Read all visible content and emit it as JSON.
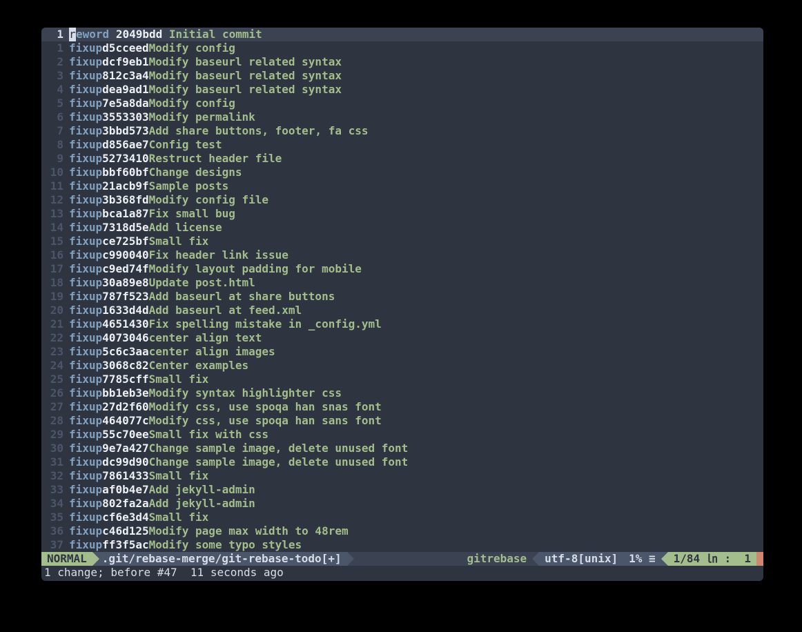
{
  "cursor_line_display": "1",
  "cursor_first_char": "r",
  "cursor_rest_cmd": "eword",
  "cursor_hash": "2049bdd",
  "cursor_msg": "Initial commit",
  "lines": [
    {
      "n": "1",
      "cmd": "fixup",
      "hash": "d5cceed",
      "msg": "Modify config"
    },
    {
      "n": "2",
      "cmd": "fixup",
      "hash": "dcf9eb1",
      "msg": "Modify baseurl related syntax"
    },
    {
      "n": "3",
      "cmd": "fixup",
      "hash": "812c3a4",
      "msg": "Modify baseurl related syntax"
    },
    {
      "n": "4",
      "cmd": "fixup",
      "hash": "dea9ad1",
      "msg": "Modify baseurl related syntax"
    },
    {
      "n": "5",
      "cmd": "fixup",
      "hash": "7e5a8da",
      "msg": "Modify config"
    },
    {
      "n": "6",
      "cmd": "fixup",
      "hash": "3553303",
      "msg": "Modify permalink"
    },
    {
      "n": "7",
      "cmd": "fixup",
      "hash": "3bbd573",
      "msg": "Add share buttons, footer, fa css"
    },
    {
      "n": "8",
      "cmd": "fixup",
      "hash": "d856ae7",
      "msg": "Config test"
    },
    {
      "n": "9",
      "cmd": "fixup",
      "hash": "5273410",
      "msg": "Restruct header file"
    },
    {
      "n": "10",
      "cmd": "fixup",
      "hash": "bbf60bf",
      "msg": "Change designs"
    },
    {
      "n": "11",
      "cmd": "fixup",
      "hash": "21acb9f",
      "msg": "Sample posts"
    },
    {
      "n": "12",
      "cmd": "fixup",
      "hash": "3b368fd",
      "msg": "Modify config file"
    },
    {
      "n": "13",
      "cmd": "fixup",
      "hash": "bca1a87",
      "msg": "Fix small bug"
    },
    {
      "n": "14",
      "cmd": "fixup",
      "hash": "7318d5e",
      "msg": "Add license"
    },
    {
      "n": "15",
      "cmd": "fixup",
      "hash": "ce725bf",
      "msg": "Small fix"
    },
    {
      "n": "16",
      "cmd": "fixup",
      "hash": "c990040",
      "msg": "Fix header link issue"
    },
    {
      "n": "17",
      "cmd": "fixup",
      "hash": "c9ed74f",
      "msg": "Modify layout padding for mobile"
    },
    {
      "n": "18",
      "cmd": "fixup",
      "hash": "30a89e8",
      "msg": "Update post.html"
    },
    {
      "n": "19",
      "cmd": "fixup",
      "hash": "787f523",
      "msg": "Add baseurl at share buttons"
    },
    {
      "n": "20",
      "cmd": "fixup",
      "hash": "1633d4d",
      "msg": "Add baseurl at feed.xml"
    },
    {
      "n": "21",
      "cmd": "fixup",
      "hash": "4651430",
      "msg": "Fix spelling mistake in _config.yml"
    },
    {
      "n": "22",
      "cmd": "fixup",
      "hash": "4073046",
      "msg": "center align text"
    },
    {
      "n": "23",
      "cmd": "fixup",
      "hash": "5c6c3aa",
      "msg": "center align images"
    },
    {
      "n": "24",
      "cmd": "fixup",
      "hash": "3068c82",
      "msg": "Center examples"
    },
    {
      "n": "25",
      "cmd": "fixup",
      "hash": "7785cff",
      "msg": "Small fix"
    },
    {
      "n": "26",
      "cmd": "fixup",
      "hash": "bb1eb3e",
      "msg": "Modify syntax highlighter css"
    },
    {
      "n": "27",
      "cmd": "fixup",
      "hash": "27d2f60",
      "msg": "Modify css, use spoqa han snas font"
    },
    {
      "n": "28",
      "cmd": "fixup",
      "hash": "464077c",
      "msg": "Modify css, use spoqa han sans font"
    },
    {
      "n": "29",
      "cmd": "fixup",
      "hash": "55c70ee",
      "msg": "Small fix with css"
    },
    {
      "n": "30",
      "cmd": "fixup",
      "hash": "9e7a427",
      "msg": "Change sample image, delete unused font"
    },
    {
      "n": "31",
      "cmd": "fixup",
      "hash": "dc99d90",
      "msg": "Change sample image, delete unused font"
    },
    {
      "n": "32",
      "cmd": "fixup",
      "hash": "7861433",
      "msg": "Small fix"
    },
    {
      "n": "33",
      "cmd": "fixup",
      "hash": "af0b4e7",
      "msg": "Add jekyll-admin"
    },
    {
      "n": "34",
      "cmd": "fixup",
      "hash": "802fa2a",
      "msg": "Add jekyll-admin"
    },
    {
      "n": "35",
      "cmd": "fixup",
      "hash": "cf6e3d4",
      "msg": "Small fix"
    },
    {
      "n": "36",
      "cmd": "fixup",
      "hash": "c46d125",
      "msg": "Modify page max width to 48rem"
    },
    {
      "n": "37",
      "cmd": "fixup",
      "hash": "ff3f5ac",
      "msg": "Modify some typo styles"
    }
  ],
  "status": {
    "mode": "NORMAL",
    "file": ".git/rebase-merge/git-rebase-todo[+]",
    "filetype": "gitrebase",
    "encoding": "utf-8[unix]",
    "percent": "1% ≡",
    "position": "1/84 ㏑ :  1"
  },
  "message": "1 change; before #47  11 seconds ago"
}
